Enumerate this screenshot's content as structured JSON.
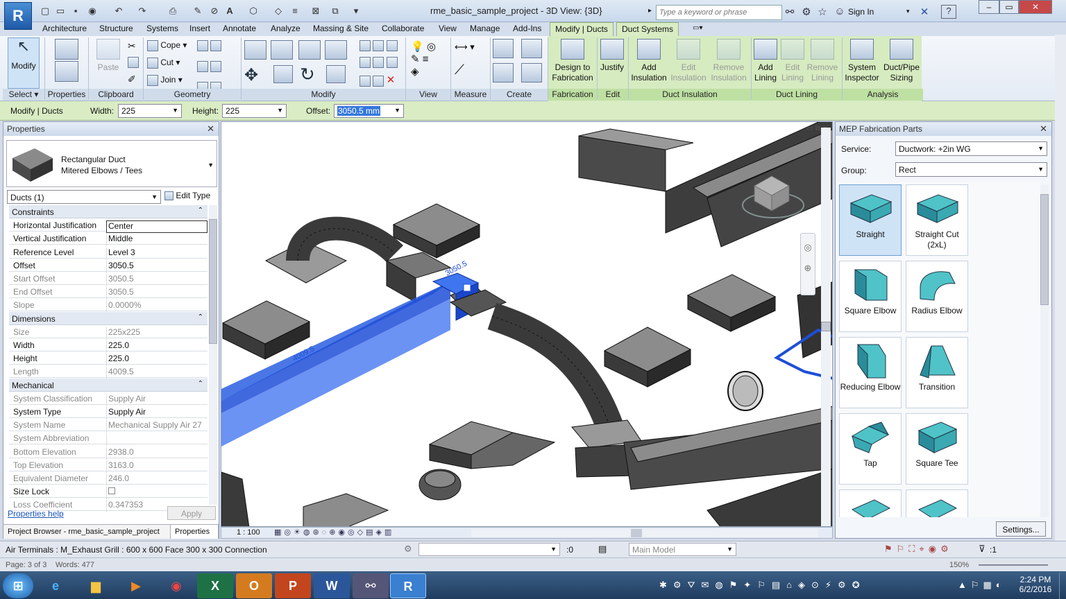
{
  "window": {
    "title": "rme_basic_sample_project - 3D View: {3D}",
    "search_placeholder": "Type a keyword or phrase",
    "sign_in": "Sign In"
  },
  "app_logo": "R",
  "tabs": [
    "Architecture",
    "Structure",
    "Systems",
    "Insert",
    "Annotate",
    "Analyze",
    "Massing & Site",
    "Collaborate",
    "View",
    "Manage",
    "Add-Ins"
  ],
  "context_tabs": {
    "modify": "Modify | Ducts",
    "duct_systems": "Duct Systems"
  },
  "ribbon": {
    "modify": "Modify",
    "properties": "Properties",
    "paste": "Paste",
    "cope": "Cope",
    "cut": "Cut",
    "join": "Join",
    "design_to_fab": [
      "Design to",
      "Fabrication"
    ],
    "justify": "Justify",
    "add_ins": [
      "Add",
      "Insulation"
    ],
    "edit_ins": [
      "Edit",
      "Insulation"
    ],
    "remove_ins": [
      "Remove",
      "Insulation"
    ],
    "add_lin": [
      "Add",
      "Lining"
    ],
    "edit_lin": [
      "Edit",
      "Lining"
    ],
    "remove_lin": [
      "Remove",
      "Lining"
    ],
    "sys_insp": [
      "System",
      "Inspector"
    ],
    "duct_sizing": [
      "Duct/Pipe",
      "Sizing"
    ],
    "panels": {
      "select": "Select",
      "properties": "Properties",
      "clipboard": "Clipboard",
      "geometry": "Geometry",
      "modify": "Modify",
      "view": "View",
      "measure": "Measure",
      "create": "Create",
      "fabrication": "Fabrication",
      "edit": "Edit",
      "duct_insulation": "Duct Insulation",
      "duct_lining": "Duct Lining",
      "analysis": "Analysis"
    }
  },
  "options": {
    "context": "Modify | Ducts",
    "width_label": "Width:",
    "width": "225",
    "height_label": "Height:",
    "height": "225",
    "offset_label": "Offset:",
    "offset": "3050.5 mm"
  },
  "properties": {
    "title": "Properties",
    "type_name": "Rectangular Duct",
    "type_sub": "Mitered Elbows / Tees",
    "selector": "Ducts (1)",
    "edit_type": "Edit Type",
    "groups": {
      "constraints": "Constraints",
      "dimensions": "Dimensions",
      "mechanical": "Mechanical"
    },
    "rows": [
      {
        "k": "Horizontal Justification",
        "v": "Center"
      },
      {
        "k": "Vertical Justification",
        "v": "Middle"
      },
      {
        "k": "Reference Level",
        "v": "Level 3"
      },
      {
        "k": "Offset",
        "v": "3050.5"
      },
      {
        "k": "Start Offset",
        "v": "3050.5"
      },
      {
        "k": "End Offset",
        "v": "3050.5"
      },
      {
        "k": "Slope",
        "v": "0.0000%"
      },
      {
        "k": "Size",
        "v": "225x225"
      },
      {
        "k": "Width",
        "v": "225.0"
      },
      {
        "k": "Height",
        "v": "225.0"
      },
      {
        "k": "Length",
        "v": "4009.5"
      },
      {
        "k": "System Classification",
        "v": "Supply Air"
      },
      {
        "k": "System Type",
        "v": "Supply Air"
      },
      {
        "k": "System Name",
        "v": "Mechanical Supply Air 27"
      },
      {
        "k": "System Abbreviation",
        "v": ""
      },
      {
        "k": "Bottom Elevation",
        "v": "2938.0"
      },
      {
        "k": "Top Elevation",
        "v": "3163.0"
      },
      {
        "k": "Equivalent Diameter",
        "v": "246.0"
      },
      {
        "k": "Size Lock",
        "v": ""
      },
      {
        "k": "Loss Coefficient",
        "v": "0.347353"
      }
    ],
    "help": "Properties help",
    "apply": "Apply",
    "bottom_tabs": [
      "Project Browser - rme_basic_sample_project",
      "Properties"
    ]
  },
  "viewport": {
    "dim1": "3050.5",
    "dim2": "4009.5",
    "scale": "1 : 100"
  },
  "mep": {
    "title": "MEP Fabrication Parts",
    "service_label": "Service:",
    "service": "Ductwork: +2in WG",
    "group_label": "Group:",
    "group": "Rect",
    "parts": [
      "Straight",
      "Straight Cut (2xL)",
      "Square Elbow",
      "Radius Elbow",
      "Reducing Elbow",
      "Transition",
      "Tap",
      "Square Tee"
    ],
    "settings": "Settings..."
  },
  "status": {
    "text": "Air Terminals : M_Exhaust Grill : 600 x 600 Face 300 x 300 Connection",
    "sel_count": ":0",
    "model": "Main Model",
    "filter": ":1"
  },
  "word": {
    "page": "Page: 3 of 3",
    "words": "Words: 477",
    "zoom": "150%"
  },
  "clock": {
    "time": "2:24 PM",
    "date": "6/2/2016"
  },
  "colors": {
    "accent_green": "#d9ecc4",
    "selection_blue": "#1e4fd8",
    "part_teal": "#4fc3c8"
  }
}
